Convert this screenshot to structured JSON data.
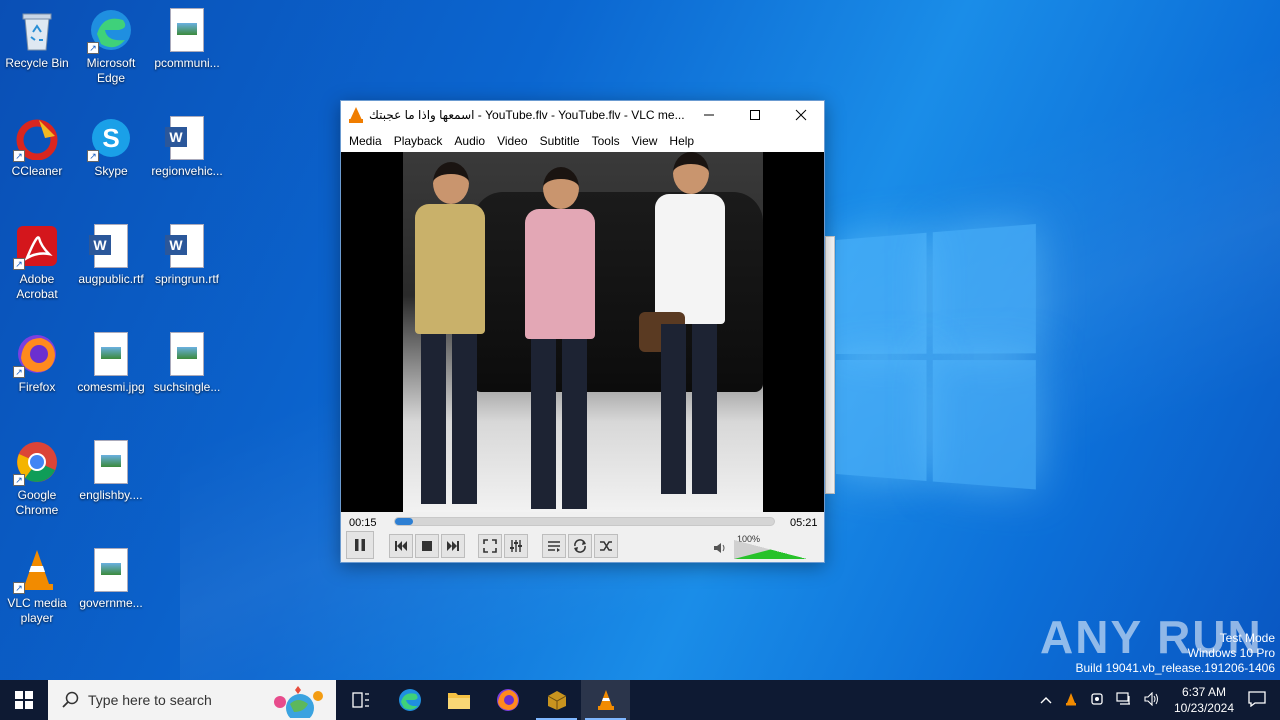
{
  "desktop": {
    "icons": [
      {
        "label": "Recycle Bin"
      },
      {
        "label": "Microsoft Edge"
      },
      {
        "label": "pcommuni..."
      },
      {
        "label": "CCleaner"
      },
      {
        "label": "Skype"
      },
      {
        "label": "regionvehic..."
      },
      {
        "label": "Adobe Acrobat"
      },
      {
        "label": "augpublic.rtf"
      },
      {
        "label": "springrun.rtf"
      },
      {
        "label": "Firefox"
      },
      {
        "label": "comesmi.jpg"
      },
      {
        "label": "suchsingle..."
      },
      {
        "label": "Google Chrome"
      },
      {
        "label": "englishby...."
      },
      {
        "label": "VLC media player"
      },
      {
        "label": "governme..."
      }
    ]
  },
  "vlc": {
    "title": "اسمعها واذا ما عجبتك - YouTube.flv - YouTube.flv - VLC me...",
    "menu": [
      "Media",
      "Playback",
      "Audio",
      "Video",
      "Subtitle",
      "Tools",
      "View",
      "Help"
    ],
    "elapsed": "00:15",
    "duration": "05:21",
    "progress_fraction": 0.047,
    "volume_label": "100%",
    "volume_fraction": 1.0,
    "accent": "#2d7fd3"
  },
  "taskbar": {
    "search_placeholder": "Type here to search",
    "time": "6:37 AM",
    "date": "10/23/2024"
  },
  "watermark": {
    "brand": "ANY RUN",
    "line1": "Test Mode",
    "line2": "Windows 10 Pro",
    "line3": "Build 19041.vb_release.191206-1406"
  }
}
